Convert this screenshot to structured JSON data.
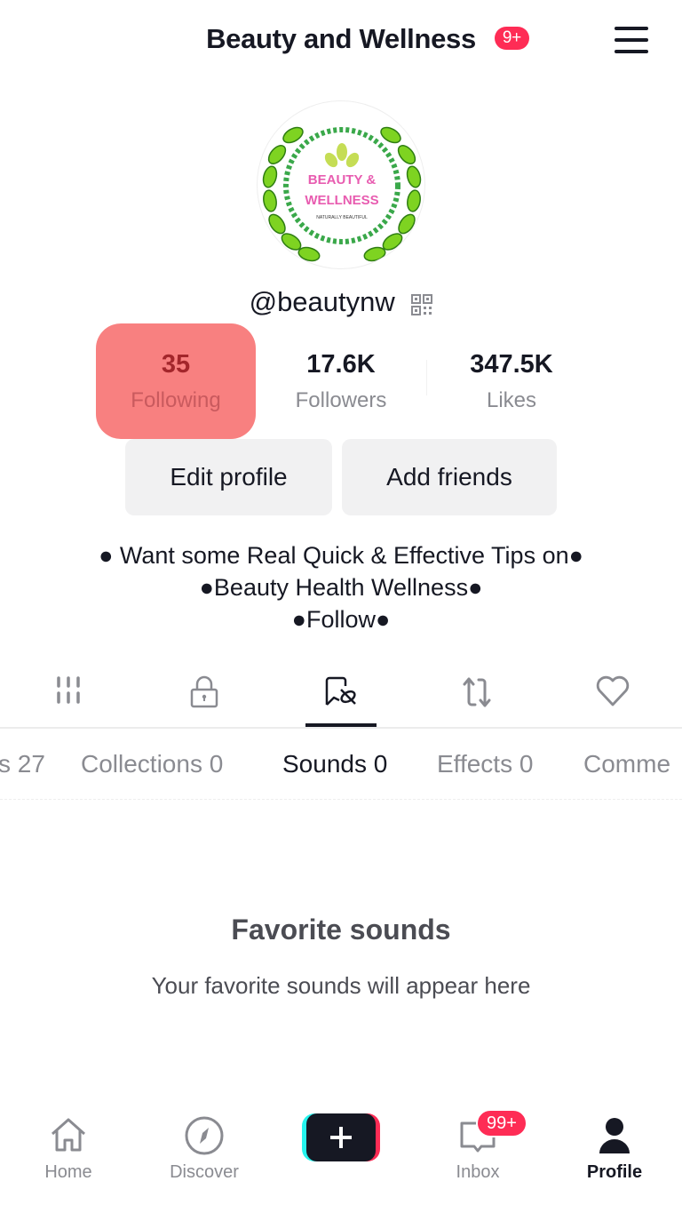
{
  "header": {
    "title": "Beauty and Wellness",
    "badge": "9+",
    "menu_icon": "hamburger-menu-icon"
  },
  "profile": {
    "avatar": {
      "line1": "BEAUTY &",
      "line2": "WELLNESS",
      "tagline": "NATURALLY BEAUTIFUL"
    },
    "username": "@beautynw",
    "qr_icon": "qr-code-icon"
  },
  "stats": [
    {
      "value": "35",
      "label": "Following",
      "highlighted": true
    },
    {
      "value": "17.6K",
      "label": "Followers"
    },
    {
      "value": "347.5K",
      "label": "Likes"
    }
  ],
  "actions": {
    "edit_profile": "Edit profile",
    "add_friends": "Add friends"
  },
  "bio": {
    "line1": "● Want some Real Quick & Effective Tips on●",
    "line2": "●Beauty Health Wellness●",
    "line3": "●Follow●"
  },
  "icon_tabs": [
    {
      "icon": "videos-grid-icon",
      "active": false
    },
    {
      "icon": "private-lock-icon",
      "active": false
    },
    {
      "icon": "favorites-bookmark-icon",
      "active": true
    },
    {
      "icon": "reposts-icon",
      "active": false
    },
    {
      "icon": "liked-heart-icon",
      "active": false
    }
  ],
  "sub_tabs": [
    {
      "label": "s 27",
      "active": false
    },
    {
      "label": "Collections 0",
      "active": false
    },
    {
      "label": "Sounds 0",
      "active": true
    },
    {
      "label": "Effects 0",
      "active": false
    },
    {
      "label": "Comme",
      "active": false
    }
  ],
  "empty_state": {
    "title": "Favorite sounds",
    "subtitle": "Your favorite sounds will appear here"
  },
  "bottom_nav": {
    "home": "Home",
    "discover": "Discover",
    "create": "+",
    "inbox": "Inbox",
    "inbox_badge": "99+",
    "profile": "Profile"
  },
  "colors": {
    "accent": "#fe2c55",
    "cyan": "#25f4ee",
    "highlight": "#f88080",
    "text": "#161823",
    "muted": "#8a8b91"
  }
}
